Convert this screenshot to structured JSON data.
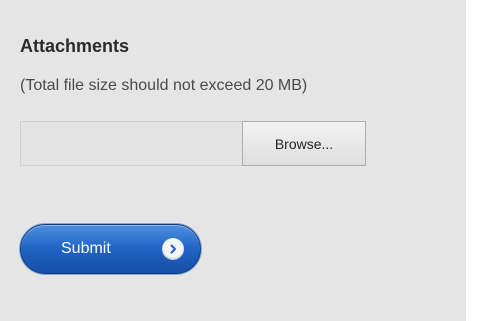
{
  "attachments": {
    "title": "Attachments",
    "hint": "(Total file size should not exceed 20 MB)",
    "file_path_value": "",
    "browse_label": "Browse..."
  },
  "submit": {
    "label": "Submit",
    "icon": "chevron-right-icon"
  },
  "colors": {
    "panel_background": "#e5e5e5",
    "submit_blue": "#1f62c4"
  }
}
